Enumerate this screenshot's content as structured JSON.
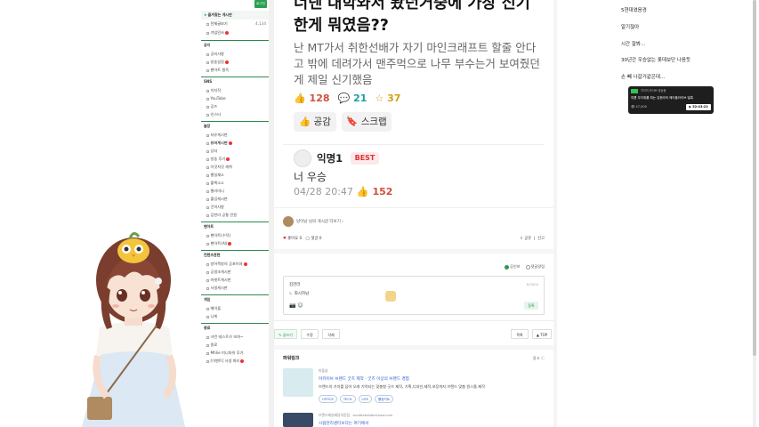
{
  "sidebar": {
    "login_button": "로그인",
    "favorites_header": "즐겨찾는 게시판",
    "all_posts_label": "전체글보기",
    "all_posts_count": "4,134",
    "greeting_label": "가입인사",
    "sections": [
      {
        "title": "공지",
        "items": [
          {
            "label": "공지사항",
            "bold": false,
            "badge": false
          },
          {
            "label": "방송일정",
            "bold": false,
            "badge": true
          },
          {
            "label": "팬아트 필독",
            "bold": false,
            "badge": false
          }
        ]
      },
      {
        "title": "SNS",
        "items": [
          {
            "label": "치지직",
            "bold": false,
            "badge": false
          },
          {
            "label": "YouTube",
            "bold": false,
            "badge": false
          },
          {
            "label": "공즈",
            "bold": false,
            "badge": false
          },
          {
            "label": "인스타",
            "bold": false,
            "badge": false
          }
        ]
      },
      {
        "title": "놀장",
        "items": [
          {
            "label": "자유게시판",
            "bold": false,
            "badge": false
          },
          {
            "label": "유머게시판",
            "bold": true,
            "badge": true
          },
          {
            "label": "상자",
            "bold": false,
            "badge": false
          },
          {
            "label": "방송 후기",
            "bold": false,
            "badge": true
          },
          {
            "label": "이것저것 캐취",
            "bold": false,
            "badge": false
          },
          {
            "label": "짤실재소",
            "bold": false,
            "badge": false
          },
          {
            "label": "출첵소소",
            "bold": false,
            "badge": false
          },
          {
            "label": "짤러미니",
            "bold": false,
            "badge": false
          },
          {
            "label": "출업게시판",
            "bold": false,
            "badge": false
          },
          {
            "label": "건의사항",
            "bold": false,
            "badge": false
          },
          {
            "label": "김한라 공통 민원",
            "bold": false,
            "badge": false
          }
        ]
      },
      {
        "title": "팬아트",
        "items": [
          {
            "label": "팬아트(수작)",
            "bold": false,
            "badge": false
          },
          {
            "label": "팬아트(AI)",
            "bold": false,
            "badge": true
          }
        ]
      },
      {
        "title": "컨텐츠관련",
        "items": [
          {
            "label": "방어쪽방의 공포이야",
            "bold": false,
            "badge": true
          },
          {
            "label": "공생조게시판",
            "bold": false,
            "badge": false
          },
          {
            "label": "마셋트게시판",
            "bold": false,
            "badge": false
          },
          {
            "label": "사생게시판",
            "bold": false,
            "badge": false
          }
        ]
      },
      {
        "title": "게임",
        "items": [
          {
            "label": "메이플",
            "bold": false,
            "badge": false
          },
          {
            "label": "니케",
            "bold": false,
            "badge": false
          }
        ]
      },
      {
        "title": "종료",
        "items": [
          {
            "label": "녀런 테스트가 보여~",
            "bold": false,
            "badge": false
          },
          {
            "label": "종료",
            "bold": false,
            "badge": false
          },
          {
            "label": "Mhlie 미니마쉬 후기",
            "bold": false,
            "badge": false
          },
          {
            "label": "[이벤트] 사생 파티",
            "bold": false,
            "badge": true
          }
        ]
      }
    ]
  },
  "post": {
    "title": "너넨 대학와서 봤던거중에 가장 신기한게 뭐였음??",
    "body": "난 MT가서 취한선배가 자기 마인크래프트 할줄 안다고 밖에 데려가서 맨주먹으로 나무 부수는거 보여줬던게 제일 신기했음",
    "likes": "128",
    "comments": "21",
    "stars": "37",
    "empathy_label": "공감",
    "scrap_label": "스크랩"
  },
  "best_comment": {
    "author": "익명1",
    "badge": "BEST",
    "text": "너 우승",
    "date": "04/28 20:47",
    "likes": "152"
  },
  "author_row": "냥이님 님의 게시글 더보기 ›",
  "tools": {
    "like": "좋아요 0",
    "comment": "댓글 0",
    "share": "공유",
    "report": "신고"
  },
  "reply": {
    "opt1": "공인보",
    "opt2": "댓글알림",
    "nickname": "김한라",
    "text": "ㄴ 최시하님",
    "counter": "6/3000",
    "submit": "등록"
  },
  "bottom_buttons": {
    "write": "글쓰기",
    "edit": "수정",
    "delete": "삭제",
    "list": "목록",
    "top": "▲ TOP"
  },
  "power_link": {
    "title": "파워링크",
    "right": "광고 ⓘ",
    "ad1": {
      "source": "마플샵",
      "title": "아카이브 브랜드 굿즈 제작 · 굿즈 이상의 브랜드 경험",
      "desc": "브랜드의 가치를 담아 오래 기억되는 맞춤형 굿즈 제작, 기획,디자인,제작,포장까지 브랜드 맞춤 원스톱 제작",
      "tags": [
        "OFFICE",
        "TECH",
        "LIFE",
        "웰컴키트"
      ]
    },
    "ad2": {
      "source": "브랜드배송배달의장점 · buddiebubbleshow.com",
      "title": "시럽관리센터보다는 여기에서"
    }
  },
  "right_panel": {
    "links": [
      "5현대였음경",
      "알기잖아",
      "시간 잘봐...",
      "30년간 우승없는 롯데보단 나음듯",
      "손 빼 나갈거같은데..."
    ],
    "stream": {
      "channel": "치지직 라이브 방송중",
      "title": "여름 무더위를 피는 김한라의 메이플라이브 밀흑",
      "views": "👁 47,000",
      "time": "▶ 52:43:22"
    }
  }
}
